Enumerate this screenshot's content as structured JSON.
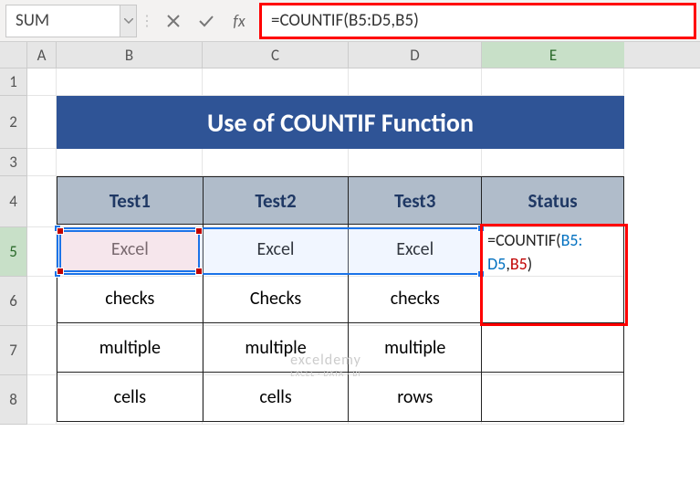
{
  "namebox": "SUM",
  "formula": "=COUNTIF(B5:D5,B5)",
  "columns": [
    "A",
    "B",
    "C",
    "D",
    "E"
  ],
  "rows": [
    "1",
    "2",
    "3",
    "4",
    "5",
    "6",
    "7",
    "8"
  ],
  "activeRow": "5",
  "activeCol": "E",
  "title": "Use of COUNTIF Function",
  "table": {
    "headers": [
      "Test1",
      "Test2",
      "Test3",
      "Status"
    ],
    "rows": [
      [
        "Excel",
        "Excel",
        "Excel",
        ""
      ],
      [
        "checks",
        "Checks",
        "checks",
        ""
      ],
      [
        "multiple",
        "multiple",
        "multiple",
        ""
      ],
      [
        "cells",
        "cells",
        "rows",
        ""
      ]
    ]
  },
  "formulaDisplay": {
    "t1": "=COUNTIF(",
    "t2": "B5:",
    "t3": "D5",
    "t4": ",",
    "t5": "B5",
    "t6": ")"
  },
  "watermark": {
    "main": "exceldemy",
    "sub": "EXCEL · DATA · BI"
  },
  "chart_data": null
}
